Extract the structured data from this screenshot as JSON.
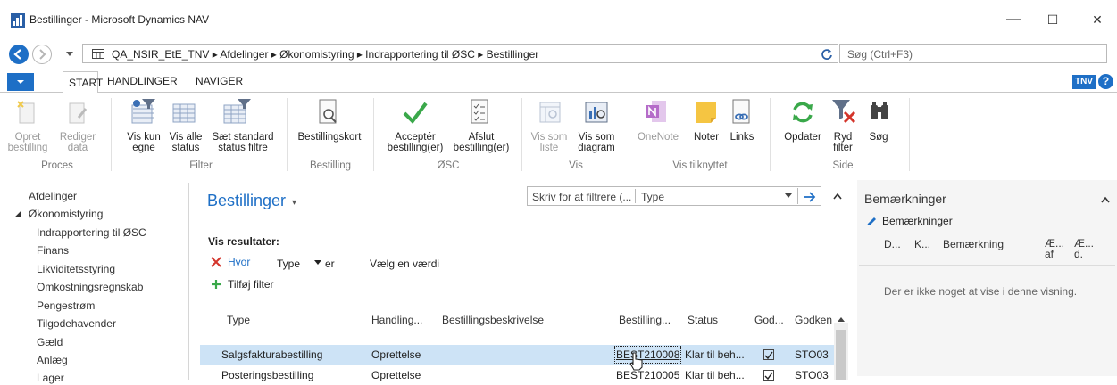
{
  "window": {
    "title": "Bestillinger - Microsoft Dynamics NAV",
    "minimize": "—",
    "maximize": "☐",
    "close": "✕"
  },
  "address": {
    "path": "QA_NSIR_EtE_TNV  ▸  Afdelinger  ▸  Økonomistyring  ▸  Indrapportering til ØSC  ▸  Bestillinger",
    "search_placeholder": "Søg (Ctrl+F3)"
  },
  "tabs": {
    "start": "START",
    "handlinger": "HANDLINGER",
    "naviger": "NAVIGER",
    "user": "TNV"
  },
  "ribbon": {
    "opret": [
      "Opret",
      "bestilling"
    ],
    "rediger": [
      "Rediger",
      "data"
    ],
    "vis_kun": [
      "Vis kun",
      "egne"
    ],
    "vis_alle": [
      "Vis alle",
      "status"
    ],
    "saet": [
      "Sæt standard",
      "status filtre"
    ],
    "bestillingskort": "Bestillingskort",
    "accepter": [
      "Acceptér",
      "bestilling(er)"
    ],
    "afslut": [
      "Afslut",
      "bestilling(er)"
    ],
    "vis_liste": [
      "Vis som",
      "liste"
    ],
    "vis_diagram": [
      "Vis som",
      "diagram"
    ],
    "onenote": "OneNote",
    "noter": "Noter",
    "links": "Links",
    "opdater": "Opdater",
    "ryd": [
      "Ryd",
      "filter"
    ],
    "soeg": "Søg",
    "groups": {
      "proces": "Proces",
      "filter": "Filter",
      "bestilling": "Bestilling",
      "osc": "ØSC",
      "vis": "Vis",
      "vis_tilknyttet": "Vis tilknyttet",
      "side": "Side"
    }
  },
  "nav": {
    "items": [
      "Afdelinger",
      "Økonomistyring",
      "Indrapportering til ØSC",
      "Finans",
      "Likviditetsstyring",
      "Omkostningsregnskab",
      "Pengestrøm",
      "Tilgodehavender",
      "Gæld",
      "Anlæg",
      "Lager"
    ],
    "expander": "◢"
  },
  "list": {
    "title": "Bestillinger",
    "title_caret": "▾",
    "filter_placeholder": "Skriv for at filtrere (...",
    "filter_field": "Type",
    "show_results": "Vis resultater:",
    "hvor": "Hvor",
    "filter_type": "Type",
    "filter_er": "er",
    "choose_value": "Vælg en værdi",
    "add_filter": "Tilføj filter",
    "columns": [
      "Type",
      "Handling...",
      "Bestillingsbeskrivelse",
      "Bestilling...",
      "Status",
      "God...",
      "Godken"
    ],
    "rows": [
      {
        "type": "Salgsfakturabestilling",
        "handling": "Oprettelse",
        "beskrivelse": "",
        "nr": "BEST210008",
        "status": "Klar til beh...",
        "god": true,
        "godkender": "STO03"
      },
      {
        "type": "Posteringsbestilling",
        "handling": "Oprettelse",
        "beskrivelse": "",
        "nr": "BEST210005",
        "status": "Klar til beh...",
        "god": true,
        "godkender": "STO03"
      }
    ]
  },
  "factbox": {
    "title": "Bemærkninger",
    "sub": "Bemærkninger",
    "cols": [
      "D...",
      "K...",
      "Bemærkning",
      "Æ... af",
      "Æ... d."
    ],
    "empty": "Der er ikke noget at vise i denne visning."
  },
  "colors": {
    "accent": "#1e6fc6",
    "title_blue": "#2a5fa6",
    "selected_row": "#cde3f6",
    "green": "#3aa84a",
    "red": "#d4352b"
  }
}
